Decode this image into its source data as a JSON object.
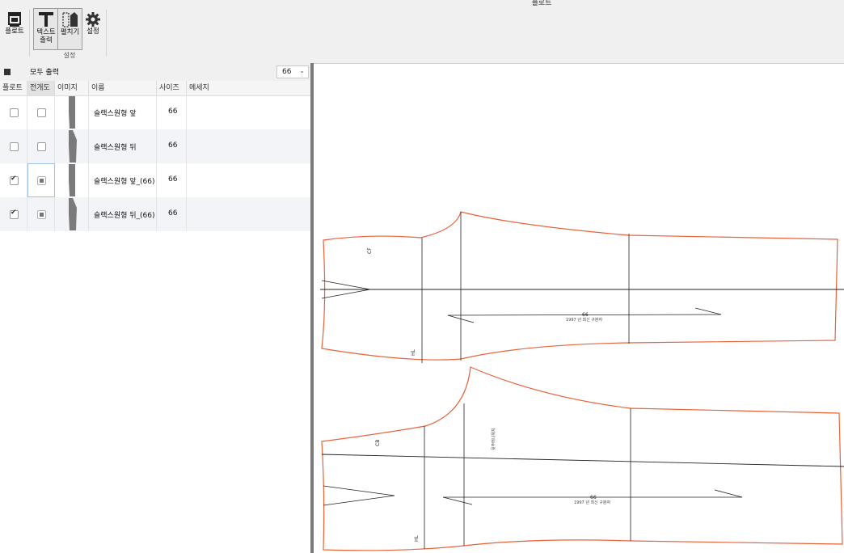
{
  "window": {
    "title": "플로트"
  },
  "toolbar": {
    "buttons": [
      {
        "label": "플로트",
        "icon": "plotter-icon"
      },
      {
        "label": "텍스트\n출력",
        "icon": "text-t-icon",
        "selected": true
      },
      {
        "label": "펼치기",
        "icon": "unfold-icon",
        "selected": true
      },
      {
        "label": "설정",
        "icon": "gear-icon"
      }
    ],
    "group_label": "설정"
  },
  "panel": {
    "print_all_label": "모두 출력",
    "size_select": {
      "value": "66",
      "chevron": "⌄"
    },
    "columns": [
      "플로트",
      "전개도",
      "이미지",
      "이름",
      "사이즈",
      "메세지"
    ],
    "rows": [
      {
        "plot": false,
        "unfold": "unchecked",
        "name": "슬랙스원형 앞",
        "size": "66",
        "message": ""
      },
      {
        "plot": false,
        "unfold": "unchecked",
        "name": "슬랙스원형 뒤",
        "size": "66",
        "message": ""
      },
      {
        "plot": true,
        "unfold": "partial",
        "name": "슬랙스원형 앞_(66)",
        "size": "66",
        "message": ""
      },
      {
        "plot": true,
        "unfold": "partial",
        "name": "슬랙스원형 뒤_(66)",
        "size": "66",
        "message": ""
      }
    ]
  },
  "canvas": {
    "front_piece": {
      "cf_label": "CF",
      "hl_label": "HL",
      "size_label": "66",
      "grain_text": "1997 년 최신 구분자"
    },
    "back_piece": {
      "cb_label": "CB",
      "hl_label": "HL",
      "size_label": "66",
      "grain_text": "1997 년 최신 구분자",
      "side_text": "뒷주머니위치"
    }
  },
  "colors": {
    "outline": "#e8633a",
    "line": "#222222",
    "accent": "#9ec3e6"
  }
}
